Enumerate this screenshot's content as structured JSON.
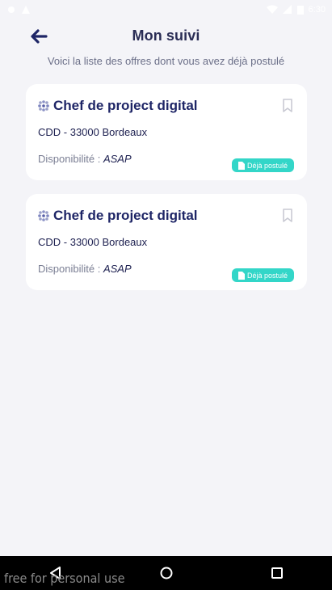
{
  "status": {
    "time": "6:30"
  },
  "header": {
    "title": "Mon suivi"
  },
  "subtitle": "Voici la liste des offres dont vous avez déjà postulé",
  "offers": [
    {
      "title": "Chef de project digital",
      "meta": "CDD - 33000 Bordeaux",
      "availability_label": "Disponibilité :",
      "availability_value": "ASAP",
      "badge": "Déjà postulé"
    },
    {
      "title": "Chef de project digital",
      "meta": "CDD - 33000 Bordeaux",
      "availability_label": "Disponibilité :",
      "availability_value": "ASAP",
      "badge": "Déjà postulé"
    }
  ],
  "watermark": "free for personal use",
  "colors": {
    "accent": "#1e2566",
    "badge": "#33d6c8",
    "background": "#f4f4f8"
  }
}
